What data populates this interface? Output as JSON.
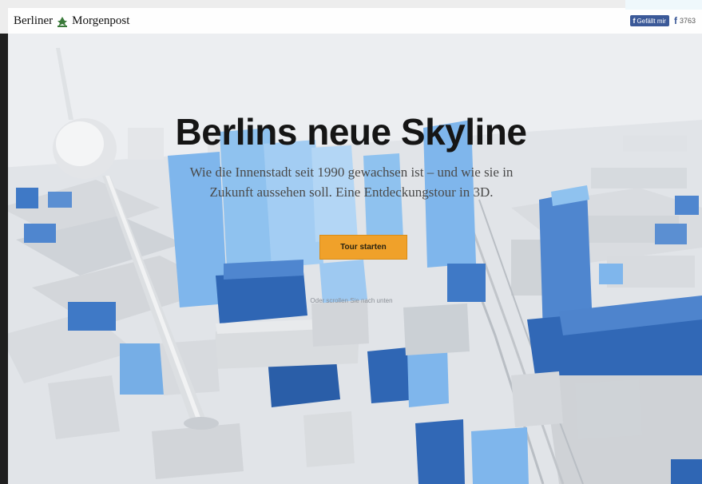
{
  "header": {
    "logo_text_left": "Berliner",
    "logo_text_right": "Morgenpost",
    "facebook": {
      "like_label": "Gefällt mir",
      "count": "3763"
    }
  },
  "hero": {
    "title": "Berlins neue Skyline",
    "subtitle": "Wie die Innenstadt seit 1990 gewachsen ist – und wie sie in Zukunft aussehen soll. Eine Entdeckungstour in 3D.",
    "cta_label": "Tour starten",
    "scroll_hint": "Oder scrollen Sie nach unten"
  },
  "colors": {
    "accent_orange": "#f0a12a",
    "building_blue": "#3f79c6",
    "building_light_blue": "#8fc2ef",
    "building_gray": "#d7d9dc",
    "facebook_blue": "#3b5998"
  }
}
